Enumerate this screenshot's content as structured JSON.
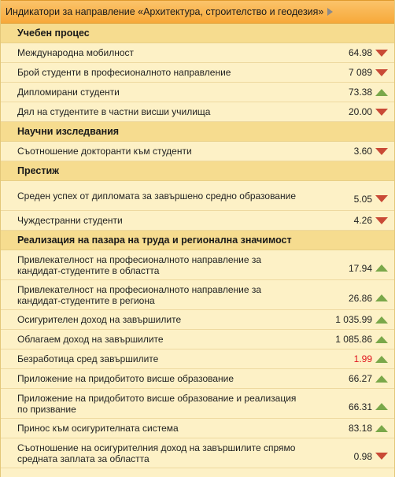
{
  "header": {
    "title": "Индикатори за направление «Архитектура, строителство и геодезия»"
  },
  "colors": {
    "up": "#7aa84a",
    "down": "#c94a36",
    "highlight": "#e0141e"
  },
  "sections": [
    {
      "title": "Учебен процес",
      "rows": [
        {
          "label": "Международна мобилност",
          "value": "64.98",
          "trend": "down"
        },
        {
          "label": "Брой студенти в професионалното направление",
          "value": "7 089",
          "trend": "down"
        },
        {
          "label": "Дипломирани студенти",
          "value": "73.38",
          "trend": "up"
        },
        {
          "label": "Дял на студентите в частни висши училища",
          "value": "20.00",
          "trend": "down"
        }
      ]
    },
    {
      "title": "Научни изследвания",
      "rows": [
        {
          "label": "Съотношение докторанти към студенти",
          "value": "3.60",
          "trend": "down"
        }
      ]
    },
    {
      "title": "Престиж",
      "rows": [
        {
          "label": "Среден успех от дипломата за завършено средно образование",
          "value": "5.05",
          "trend": "down",
          "tall": true
        },
        {
          "label": "Чуждестранни студенти",
          "value": "4.26",
          "trend": "down"
        }
      ]
    },
    {
      "title": "Реализация на пазара на труда и регионална значимост",
      "rows": [
        {
          "label": "Привлекателност на професионалното направление за кандидат-студентите в областта",
          "value": "17.94",
          "trend": "up",
          "tall": true
        },
        {
          "label": "Привлекателност на професионалното направление за кандидат-студентите в региона",
          "value": "26.86",
          "trend": "up",
          "tall": true
        },
        {
          "label": "Осигурителен доход на завършилите",
          "value": "1 035.99",
          "trend": "up"
        },
        {
          "label": "Облагаем доход на завършилите",
          "value": "1 085.86",
          "trend": "up"
        },
        {
          "label": "Безработица сред завършилите",
          "value": "1.99",
          "trend": "up",
          "red": true
        },
        {
          "label": "Приложение на придобитото висше образование",
          "value": "66.27",
          "trend": "up"
        },
        {
          "label": "Приложение на придобитото висше образование и реализация по призвание",
          "value": "66.31",
          "trend": "up",
          "tall": true
        },
        {
          "label": "Принос към осигурителната система",
          "value": "83.18",
          "trend": "up"
        },
        {
          "label": "Съотношение на осигурителния доход на завършилите спрямо средната заплата за областта",
          "value": "0.98",
          "trend": "down",
          "tall": true
        }
      ]
    }
  ]
}
